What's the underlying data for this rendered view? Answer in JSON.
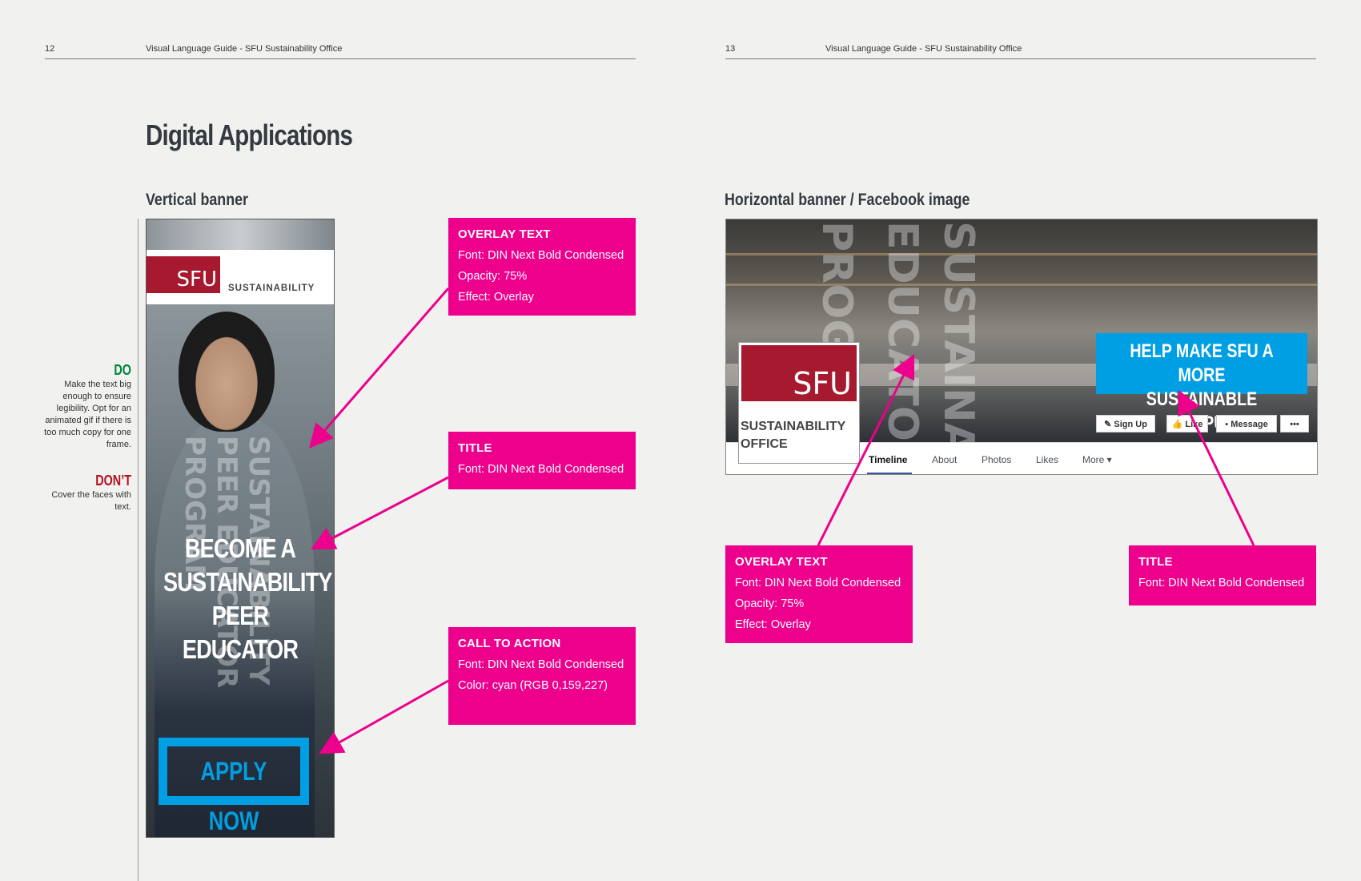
{
  "left_page": {
    "number": "12",
    "running_head": "Visual Language Guide - SFU Sustainability Office",
    "title": "Digital Applications",
    "section": "Vertical banner",
    "do": {
      "label": "DO",
      "text": "Make the text big enough to ensure legibility. Opt for an animated gif if there is too much copy for one frame."
    },
    "dont": {
      "label": "DON’T",
      "text": "Cover the faces with text."
    },
    "banner": {
      "logo_mark": "SFU",
      "logo_word": "SUSTAINABILITY",
      "title_lines": [
        "BECOME A",
        "SUSTAINABILITY",
        "PEER",
        "EDUCATOR"
      ],
      "cta": "APPLY NOW"
    },
    "callouts": [
      {
        "title": "OVERLAY TEXT",
        "lines": [
          "Font: DIN Next Bold Condensed",
          "Opacity: 75%",
          "Effect: Overlay"
        ]
      },
      {
        "title": "TITLE",
        "lines": [
          "Font: DIN Next Bold Condensed"
        ]
      },
      {
        "title": "CALL TO ACTION",
        "lines": [
          "Font: DIN Next Bold Condensed",
          "Color: cyan (RGB 0,159,227)"
        ]
      }
    ]
  },
  "right_page": {
    "number": "13",
    "running_head": "Visual Language Guide - SFU Sustainability Office",
    "section": "Horizontal banner / Facebook image",
    "banner": {
      "title_lines": [
        "HELP MAKE SFU A MORE",
        "SUSTAINABLE CAMPUS"
      ],
      "profile_mark": "SFU",
      "profile_lines": [
        "SUSTAINABILITY",
        "OFFICE"
      ],
      "buttons": {
        "signup": "Sign Up",
        "like": "Like",
        "message": "Message",
        "more": "•••"
      },
      "tabs": [
        "Timeline",
        "About",
        "Photos",
        "Likes",
        "More ▾"
      ]
    },
    "callouts": [
      {
        "title": "OVERLAY TEXT",
        "lines": [
          "Font: DIN Next Bold Condensed",
          "Opacity: 75%",
          "Effect: Overlay"
        ]
      },
      {
        "title": "TITLE",
        "lines": [
          "Font: DIN Next Bold Condensed"
        ]
      }
    ]
  },
  "colors": {
    "magenta": "#ec008c",
    "cyan": "#009fe3",
    "sfu_red": "#a6192e",
    "do_green": "#00843d",
    "dont_red": "#b5121b"
  }
}
